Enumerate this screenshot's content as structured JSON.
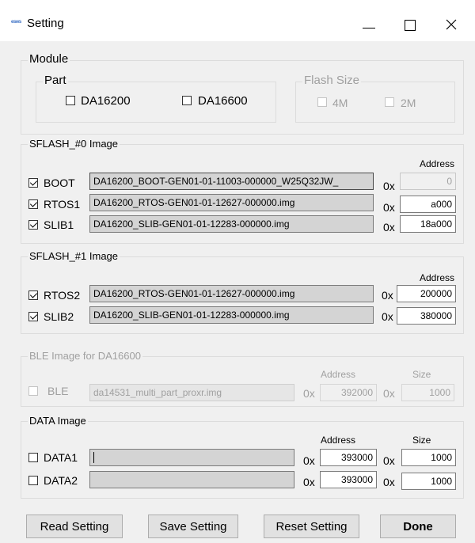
{
  "window": {
    "title": "Setting",
    "icon_text": "esws"
  },
  "module": {
    "legend": "Module",
    "part": {
      "legend": "Part",
      "options": [
        {
          "label": "DA16200",
          "checked": false
        },
        {
          "label": "DA16600",
          "checked": false
        }
      ]
    },
    "flash_size": {
      "legend": "Flash Size",
      "options": [
        {
          "label": "4M",
          "checked": false
        },
        {
          "label": "2M",
          "checked": false
        }
      ]
    }
  },
  "sflash0": {
    "legend": "SFLASH_#0 Image",
    "address_header": "Address",
    "rows": [
      {
        "label": "BOOT",
        "checked": true,
        "path": "DA16200_BOOT-GEN01-01-11003-000000_W25Q32JW_",
        "prefix": "0x",
        "address": "0"
      },
      {
        "label": "RTOS1",
        "checked": true,
        "path": "DA16200_RTOS-GEN01-01-12627-000000.img",
        "prefix": "0x",
        "address": "a000"
      },
      {
        "label": "SLIB1",
        "checked": true,
        "path": "DA16200_SLIB-GEN01-01-12283-000000.img",
        "prefix": "0x",
        "address": "18a000"
      }
    ]
  },
  "sflash1": {
    "legend": "SFLASH_#1 Image",
    "address_header": "Address",
    "rows": [
      {
        "label": "RTOS2",
        "checked": true,
        "path": "DA16200_RTOS-GEN01-01-12627-000000.img",
        "prefix": "0x",
        "address": "200000"
      },
      {
        "label": "SLIB2",
        "checked": true,
        "path": "DA16200_SLIB-GEN01-01-12283-000000.img",
        "prefix": "0x",
        "address": "380000"
      }
    ]
  },
  "ble": {
    "legend": "BLE Image for DA16600",
    "address_header": "Address",
    "size_header": "Size",
    "row": {
      "label": "BLE",
      "checked": false,
      "path": "da14531_multi_part_proxr.img",
      "prefix": "0x",
      "address": "392000",
      "size_prefix": "0x",
      "size": "1000"
    }
  },
  "data": {
    "legend": "DATA Image",
    "address_header": "Address",
    "size_header": "Size",
    "rows": [
      {
        "label": "DATA1",
        "checked": false,
        "path": "",
        "prefix": "0x",
        "address": "393000",
        "size_prefix": "0x",
        "size": "1000"
      },
      {
        "label": "DATA2",
        "checked": false,
        "path": "",
        "prefix": "0x",
        "address": "393000",
        "size_prefix": "0x",
        "size": "1000"
      }
    ]
  },
  "buttons": {
    "read": "Read Setting",
    "save": "Save Setting",
    "reset": "Reset Setting",
    "done": "Done"
  }
}
